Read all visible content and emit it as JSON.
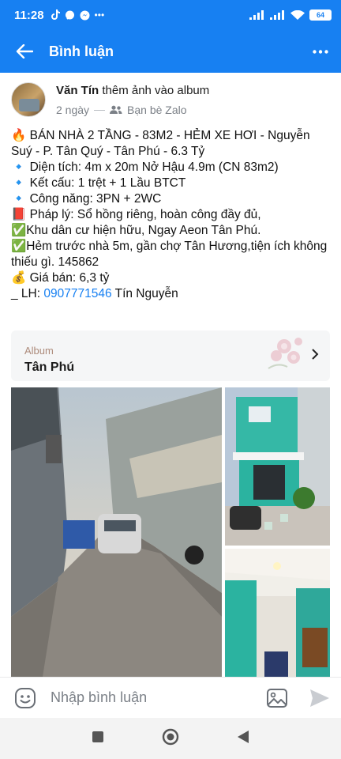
{
  "status": {
    "time": "11:28",
    "battery": "64"
  },
  "appbar": {
    "title": "Bình luận"
  },
  "post": {
    "author": "Văn Tín",
    "action": " thêm ảnh vào album",
    "time": "2 ngày",
    "audience": "Bạn bè Zalo",
    "lines": [
      "🔥 BÁN NHÀ 2 TẦNG - 83M2 - HẺM XE HƠI - Nguyễn Suý - P. Tân Quý - Tân Phú - 6.3 Tỷ",
      "🔹 Diện tích: 4m x 20m Nở Hậu 4.9m (CN 83m2)",
      "🔹 Kết cấu: 1 trệt + 1 Lầu BTCT",
      "🔹 Công năng: 3PN + 2WC",
      "📕 Pháp lý: Sổ hồng riêng, hoàn công đầy đủ,",
      "✅Khu dân cư hiện hữu, Ngay Aeon Tân Phú.",
      "✅Hẻm trước nhà 5m, gần chợ Tân Hương,tiện ích không thiếu gì. 145862",
      "💰 Giá bán: 6,3 tỷ"
    ],
    "contact_prefix": "_ LH: ",
    "phone": "0907771546",
    "contact_name": " Tín Nguyễn"
  },
  "album": {
    "label": "Album",
    "name": "Tân Phú"
  },
  "composer": {
    "placeholder": "Nhập bình luận"
  },
  "icons": {
    "back": "arrow-left-icon",
    "more": "more-dots-icon",
    "emoji": "emoji-icon",
    "image": "image-icon",
    "send": "send-icon"
  },
  "colors": {
    "brand": "#1780f2",
    "link": "#1780f2"
  }
}
